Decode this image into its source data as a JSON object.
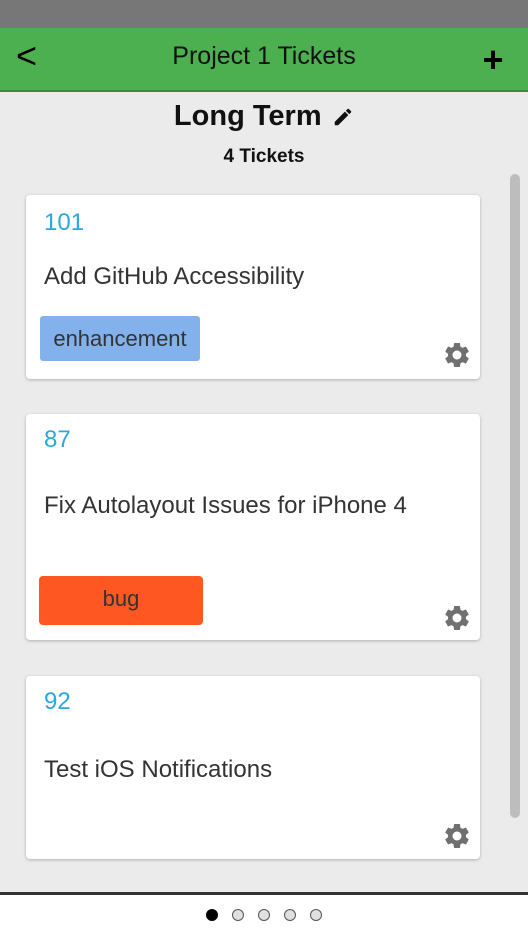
{
  "header": {
    "back_label": "<",
    "title": "Project 1 Tickets",
    "add_label": "+"
  },
  "list": {
    "title": "Long Term",
    "count_text": "4 Tickets"
  },
  "tickets": [
    {
      "number": "101",
      "title": "Add GitHub Accessibility",
      "label": "enhancement",
      "label_color": "#82b1ec"
    },
    {
      "number": "87",
      "title": "Fix Autolayout Issues for iPhone 4",
      "label": "bug",
      "label_color": "#ff5722"
    },
    {
      "number": "92",
      "title": "Test iOS Notifications"
    }
  ],
  "pager": {
    "page_count": 5,
    "current_page": 1
  },
  "colors": {
    "appbar": "#4caf50",
    "ticket_number": "#29a8e0"
  },
  "icons": [
    "back-icon",
    "add-icon",
    "pencil-icon",
    "gear-icon"
  ]
}
